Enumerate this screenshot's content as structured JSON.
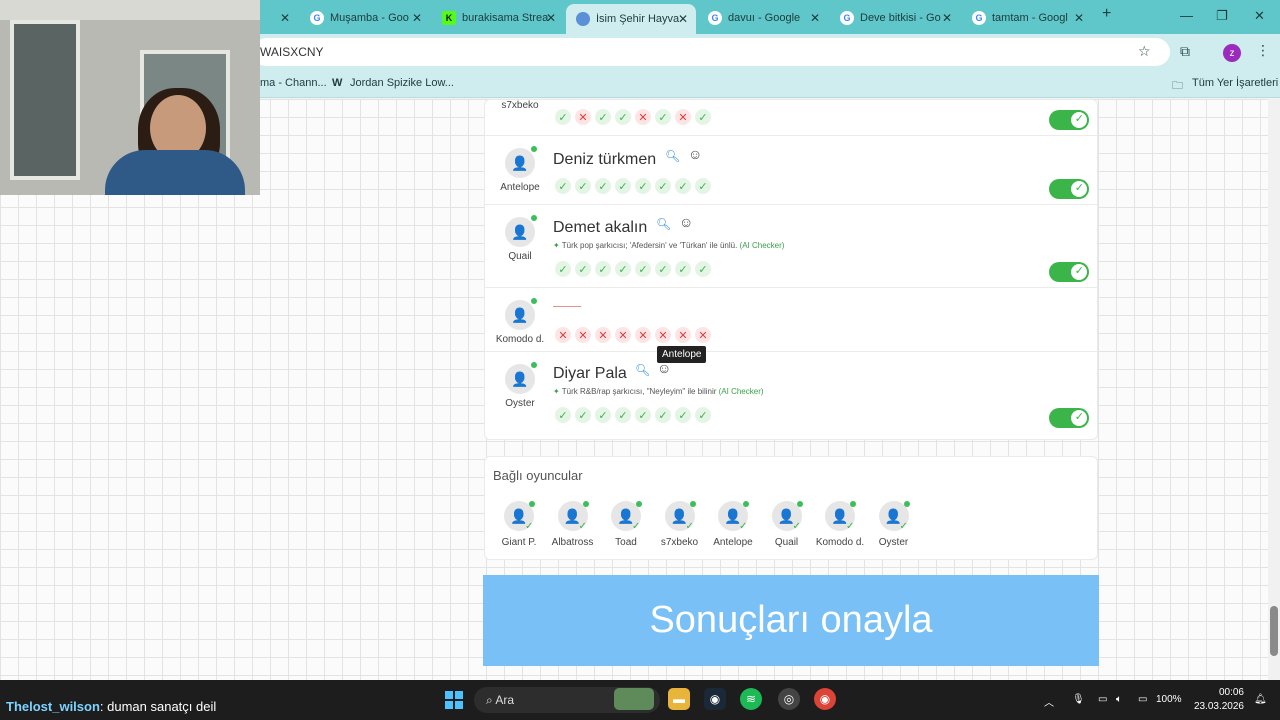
{
  "browser": {
    "tabs": [
      {
        "title": "",
        "favicon": "",
        "active": false
      },
      {
        "title": "Muşamba - Goo",
        "favicon": "G",
        "active": false
      },
      {
        "title": "burakisama Strea",
        "favicon": "K",
        "active": false
      },
      {
        "title": "İsim Şehir Hayva",
        "favicon": "",
        "active": true
      },
      {
        "title": "davuı - Google",
        "favicon": "G",
        "active": false
      },
      {
        "title": "Deve bitkisi - Go",
        "favicon": "G",
        "active": false
      },
      {
        "title": "tamtam - Googl",
        "favicon": "G",
        "active": false
      }
    ],
    "url": "WAISXCNY",
    "bookmarks": [
      "ma - Chann...",
      "Jordan Spizike Low...",
      "Tüm Yer İşaretleri"
    ],
    "profile_initial": "z"
  },
  "rows": [
    {
      "player": "s7xbeko",
      "answer": "",
      "note": "",
      "marks": [
        "ok",
        "no",
        "ok",
        "ok",
        "no",
        "ok",
        "no",
        "ok"
      ],
      "toggle": true,
      "avatar_icon": "person-icon"
    },
    {
      "player": "Antelope",
      "answer": "Deniz türkmen",
      "note": "",
      "marks": [
        "ok",
        "ok",
        "ok",
        "ok",
        "ok",
        "ok",
        "ok",
        "ok"
      ],
      "toggle": true,
      "avatar_icon": "person-icon"
    },
    {
      "player": "Quail",
      "answer": "Demet akalın",
      "note": "Türk pop şarkıcısı; 'Afedersin' ve 'Türkan' ile ünlü.",
      "note_tag": "(AI Checker)",
      "marks": [
        "ok",
        "ok",
        "ok",
        "ok",
        "ok",
        "ok",
        "ok",
        "ok"
      ],
      "toggle": true,
      "avatar_icon": "person-icon"
    },
    {
      "player": "Komodo d.",
      "answer": "",
      "note": "",
      "marks": [
        "no",
        "no",
        "no",
        "no",
        "no",
        "no",
        "no",
        "no"
      ],
      "toggle": false,
      "avatar_icon": "person-icon"
    },
    {
      "player": "Oyster",
      "answer": "Diyar Pala",
      "note": "Türk R&B/rap şarkıcısı, \"Neyleyim\" ile bilinir",
      "note_tag": "(AI Checker)",
      "marks": [
        "ok",
        "ok",
        "ok",
        "ok",
        "ok",
        "ok",
        "ok",
        "ok"
      ],
      "toggle": true,
      "avatar_icon": "person-star-icon"
    }
  ],
  "tooltip": "Antelope",
  "connected": {
    "title": "Bağlı oyuncular",
    "players": [
      "Giant P.",
      "Albatross",
      "Toad",
      "s7xbeko",
      "Antelope",
      "Quail",
      "Komodo d.",
      "Oyster"
    ]
  },
  "confirm_label": "Sonuçları onayla",
  "chat": {
    "user": "Thelost_wilson",
    "message": ": duman sanatçı deil"
  },
  "taskbar": {
    "search_label": "Ara",
    "battery": "100%",
    "time": "00:06",
    "date": "23.03.2026"
  },
  "colors": {
    "accent": "#3bb54a",
    "reject": "#e03b3b",
    "confirm": "#78c0f5",
    "tabbar": "#5fc7c9"
  }
}
